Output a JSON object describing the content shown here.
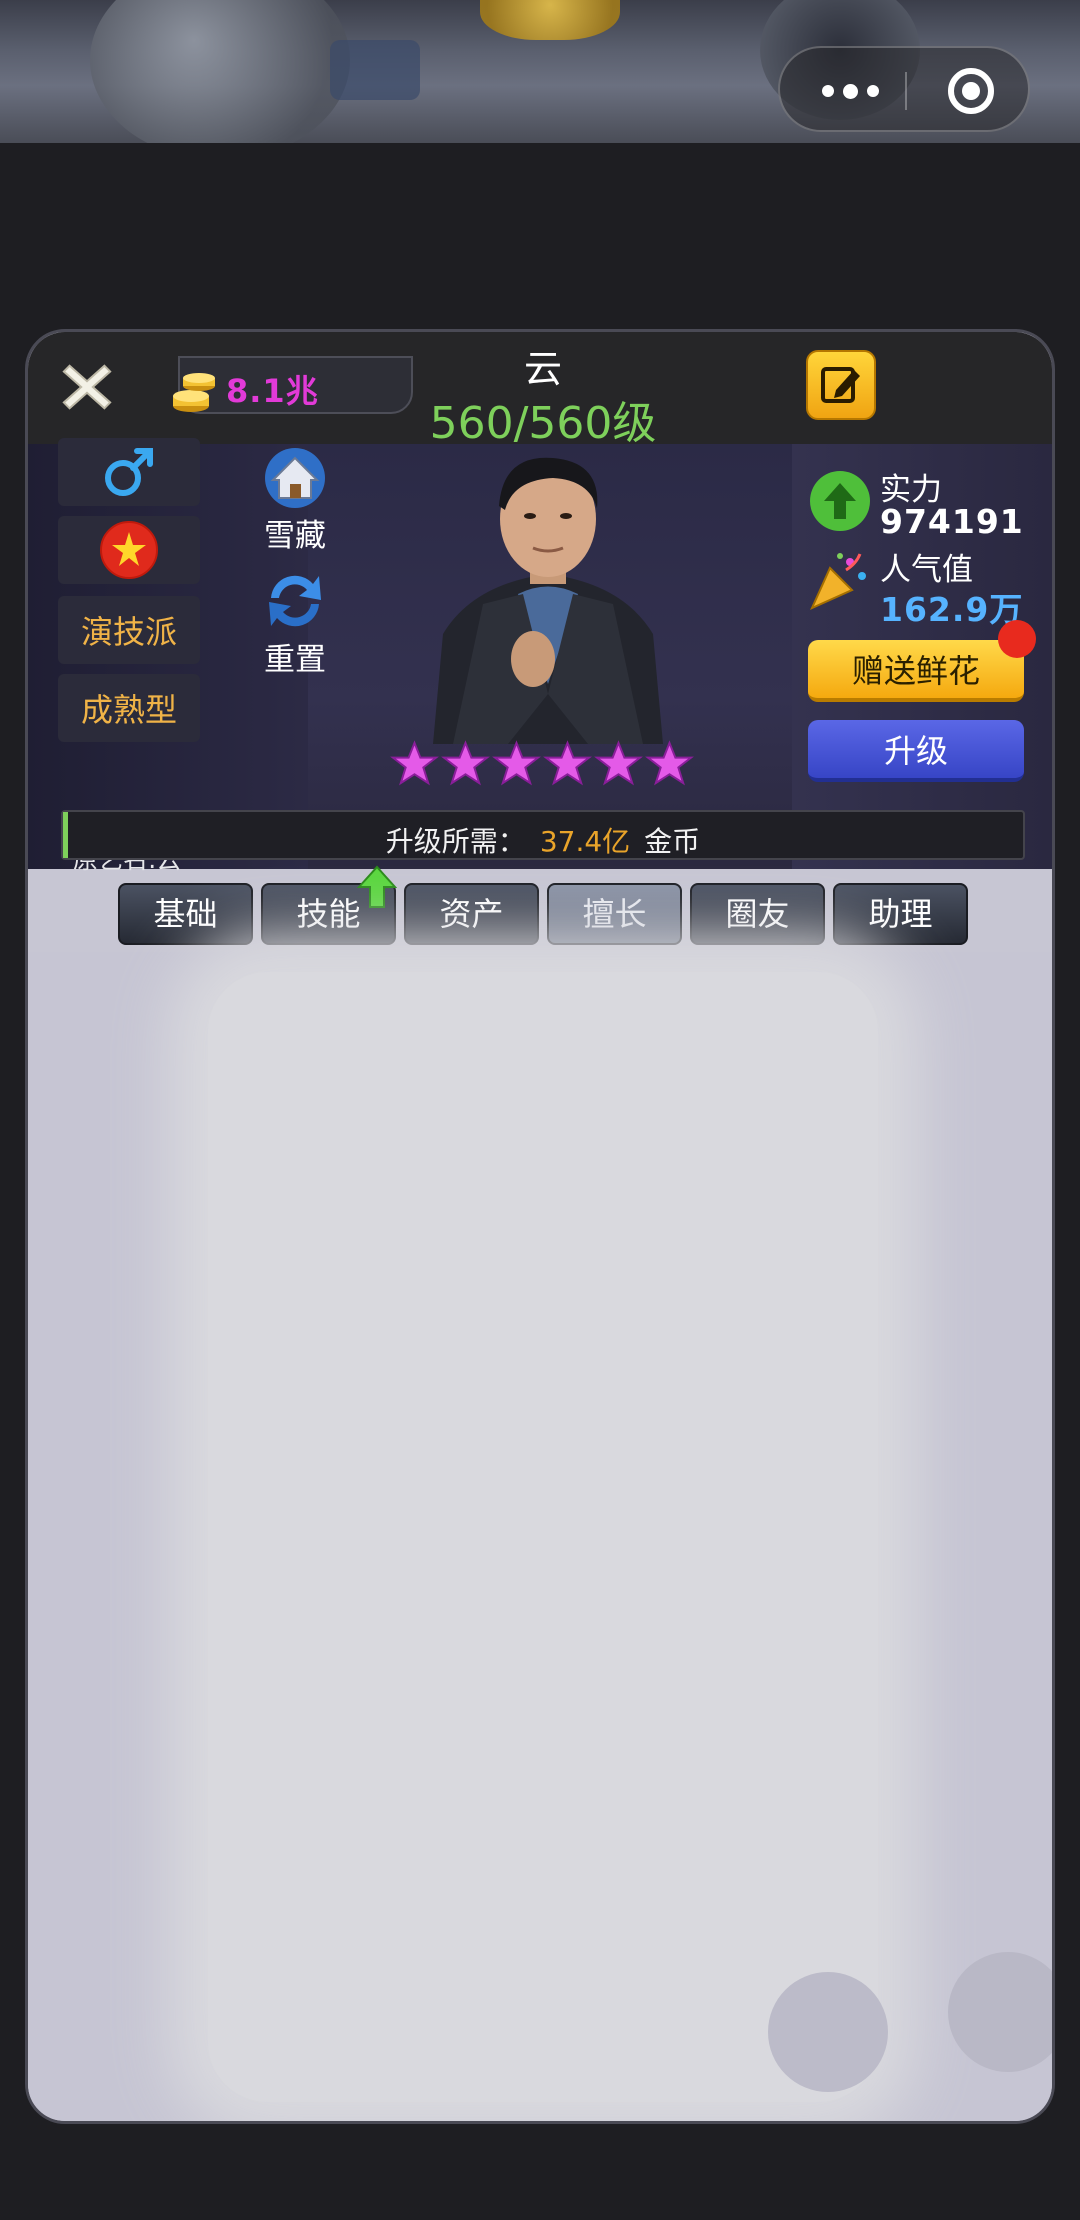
{
  "header": {
    "close_label": "×",
    "coins": "8.1兆",
    "name": "云",
    "level": "560/560级"
  },
  "profile": {
    "gender_icon": "male-icon",
    "tag1": "演技派",
    "tag2": "成熟型",
    "original_name": "原艺名:云",
    "side_actions": [
      {
        "label": "雪藏",
        "icon": "house-icon"
      },
      {
        "label": "重置",
        "icon": "refresh-icon"
      }
    ],
    "stars": 6,
    "strength_label": "实力",
    "strength_value": "974191",
    "popularity_label": "人气值",
    "popularity_value": "162.9万",
    "gift_button": "赠送鲜花",
    "upgrade_button": "升级",
    "upgrade_need_label": "升级所需：",
    "upgrade_need_amount": "37.4亿",
    "upgrade_need_unit": "金币"
  },
  "tabs": [
    {
      "label": "基础",
      "active": false
    },
    {
      "label": "技能",
      "active": false,
      "badge": "up-arrow-icon"
    },
    {
      "label": "资产",
      "active": false
    },
    {
      "label": "擅长",
      "active": true
    },
    {
      "label": "圈友",
      "active": false
    },
    {
      "label": "助理",
      "active": false
    }
  ],
  "colors": {
    "level_green": "#7ed05b",
    "coin_magenta": "#e23ad8",
    "gift_yellow": "#f5a90f",
    "upgrade_blue": "#3745c6",
    "popularity_blue": "#56b3ff",
    "star_pink": "#e45ae8"
  }
}
